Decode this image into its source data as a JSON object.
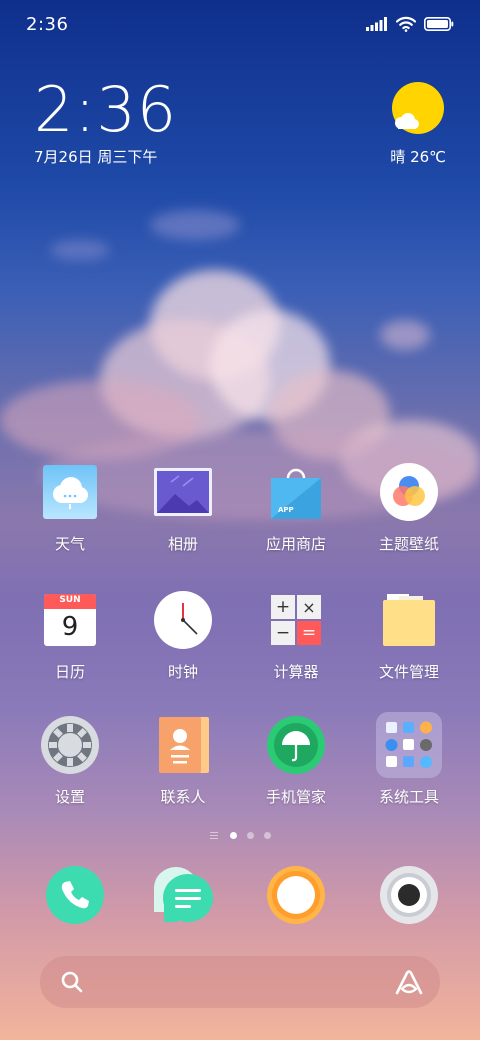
{
  "status_bar": {
    "time": "2:36"
  },
  "clock_widget": {
    "time": "2:36",
    "date": "7月26日 周三下午"
  },
  "weather_widget": {
    "condition": "晴",
    "temperature": "26℃"
  },
  "apps": [
    {
      "label": "天气",
      "icon": "weather-icon"
    },
    {
      "label": "相册",
      "icon": "gallery-icon"
    },
    {
      "label": "应用商店",
      "icon": "app-store-icon"
    },
    {
      "label": "主题壁纸",
      "icon": "themes-icon"
    },
    {
      "label": "日历",
      "icon": "calendar-icon",
      "calendar_day": "SUN",
      "calendar_date": "9"
    },
    {
      "label": "时钟",
      "icon": "clock-icon"
    },
    {
      "label": "计算器",
      "icon": "calculator-icon"
    },
    {
      "label": "文件管理",
      "icon": "file-manager-icon"
    },
    {
      "label": "设置",
      "icon": "settings-icon"
    },
    {
      "label": "联系人",
      "icon": "contacts-icon"
    },
    {
      "label": "手机管家",
      "icon": "security-icon"
    },
    {
      "label": "系统工具",
      "icon": "folder-icon"
    }
  ],
  "calculator_symbols": [
    "+",
    "×",
    "−",
    "="
  ],
  "app_store_badge": "APP",
  "page_indicator": {
    "pages": 3,
    "active": 1
  },
  "dock": [
    {
      "icon": "phone-icon"
    },
    {
      "icon": "messages-icon"
    },
    {
      "icon": "browser-icon"
    },
    {
      "icon": "camera-icon"
    }
  ],
  "colors": {
    "sun": "#ffd400",
    "phone": "#3ddbb0",
    "messages": "#3ddbb0",
    "browser": "#ffb547",
    "security": "#2bcb75"
  }
}
